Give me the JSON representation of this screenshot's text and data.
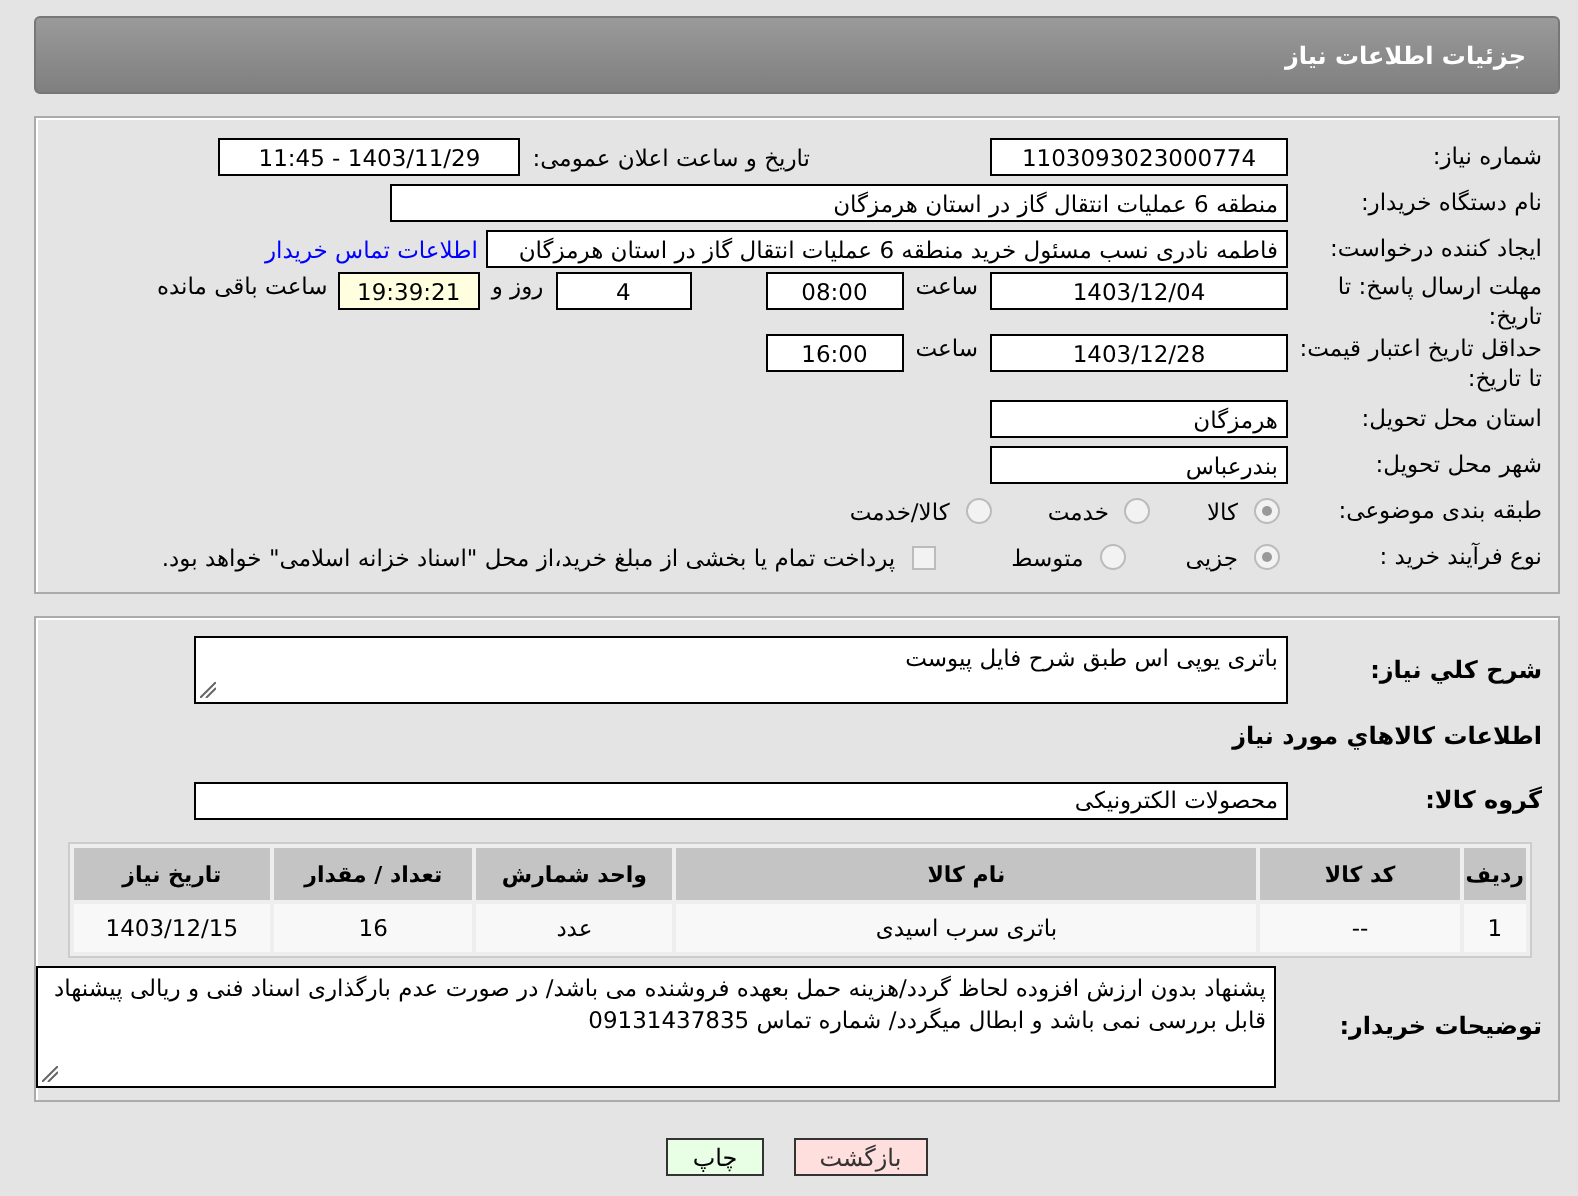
{
  "header": {
    "title": "جزئیات اطلاعات نیاز"
  },
  "need_number": {
    "label": "شماره نیاز:",
    "value": "1103093023000774"
  },
  "announce": {
    "label": "تاریخ و ساعت اعلان عمومی:",
    "value": "1403/11/29 - 11:45"
  },
  "buyer_org": {
    "label": "نام دستگاه خریدار:",
    "value": "منطقه 6 عملیات انتقال گاز در استان هرمزگان"
  },
  "requester": {
    "label": "ایجاد کننده درخواست:",
    "value": "فاطمه نادری نسب مسئول خرید منطقه 6 عملیات انتقال گاز در استان هرمزگان",
    "link": "اطلاعات تماس خریدار"
  },
  "deadline": {
    "label": "مهلت ارسال پاسخ: تا تاریخ:",
    "date": "1403/12/04",
    "time_label": "ساعت",
    "time": "08:00",
    "days": "4",
    "days_label": "روز و",
    "remaining": "19:39:21",
    "remaining_label": "ساعت باقی مانده"
  },
  "validity": {
    "label": "حداقل تاریخ اعتبار قیمت: تا تاریخ:",
    "date": "1403/12/28",
    "time_label": "ساعت",
    "time": "16:00"
  },
  "province": {
    "label": "استان محل تحویل:",
    "value": "هرمزگان"
  },
  "city": {
    "label": "شهر محل تحویل:",
    "value": "بندرعباس"
  },
  "category": {
    "label": "طبقه بندی موضوعی:",
    "options": [
      {
        "label": "کالا",
        "selected": true
      },
      {
        "label": "خدمت",
        "selected": false
      },
      {
        "label": "کالا/خدمت",
        "selected": false
      }
    ]
  },
  "process": {
    "label": "نوع فرآیند خرید :",
    "options": [
      {
        "label": "جزیی",
        "selected": true
      },
      {
        "label": "متوسط",
        "selected": false
      }
    ],
    "payment": {
      "label": "پرداخت تمام یا بخشی از مبلغ خرید،از محل \"اسناد خزانه اسلامی\" خواهد بود.",
      "checked": false
    }
  },
  "description": {
    "label": "شرح کلي نياز:",
    "value": "باتری یوپی اس طبق شرح فایل پیوست"
  },
  "goods_title": "اطلاعات کالاهاي مورد نياز",
  "goods_group": {
    "label": "گروه کالا:",
    "value": "محصولات الکترونیکی"
  },
  "table": {
    "columns": [
      "ردیف",
      "کد کالا",
      "نام کالا",
      "واحد شمارش",
      "تعداد / مقدار",
      "تاریخ نیاز"
    ],
    "rows": [
      [
        "1",
        "--",
        "باتری سرب اسیدی",
        "عدد",
        "16",
        "1403/12/15"
      ]
    ]
  },
  "buyer_notes": {
    "label": "توضیحات خریدار:",
    "value": "پشنهاد بدون ارزش افزوده لحاظ گردد/هزینه حمل بعهده فروشنده می باشد/ در صورت عدم بارگذاری اسناد فنی و ریالی پیشنهاد قابل بررسی نمی باشد و ابطال میگردد/ شماره تماس 09131437835"
  },
  "buttons": [
    {
      "label": "بازگشت",
      "kind": "back"
    },
    {
      "label": "چاپ",
      "kind": "print"
    }
  ]
}
